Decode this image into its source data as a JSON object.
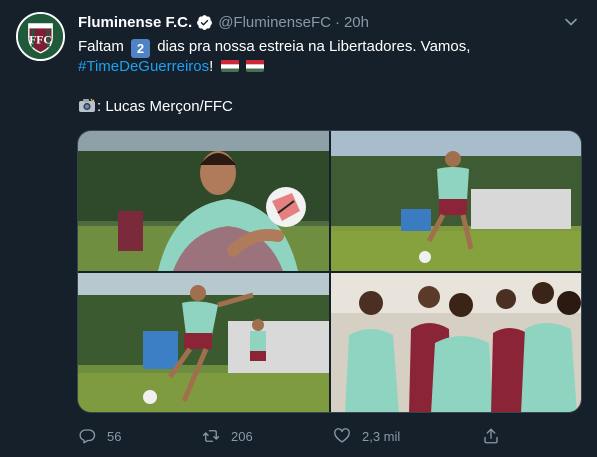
{
  "account": {
    "name": "Fluminense F.C.",
    "handle": "@FluminenseFC",
    "separator": "·",
    "time": "20h",
    "verified": true
  },
  "tweet": {
    "line1_before": "Faltam",
    "badge_number": "2",
    "line1_after": "dias pra nossa estreia na Libertadores. Vamos,",
    "hashtag": "#TimeDeGuerreiros",
    "hashtag_suffix": "!",
    "credit": ": Lucas Merçon/FFC"
  },
  "media": [
    {
      "name": "photo-player-ball-closeup"
    },
    {
      "name": "photo-player-running-field"
    },
    {
      "name": "photo-player-kicking-ball"
    },
    {
      "name": "photo-team-huddle"
    }
  ],
  "actions": {
    "replies": "56",
    "retweets": "206",
    "likes": "2,3 mil"
  },
  "colors": {
    "background": "#15202b",
    "secondary_text": "#8899a6",
    "link": "#1da1f2",
    "verified": "#ffffff",
    "club_maroon": "#7d1e35",
    "club_green": "#1f5a3a"
  },
  "icons": [
    "club-crest-icon",
    "verified-badge-icon",
    "chevron-down-icon",
    "hungary-flag-icon",
    "camera-icon",
    "reply-icon",
    "retweet-icon",
    "like-icon",
    "share-icon"
  ]
}
